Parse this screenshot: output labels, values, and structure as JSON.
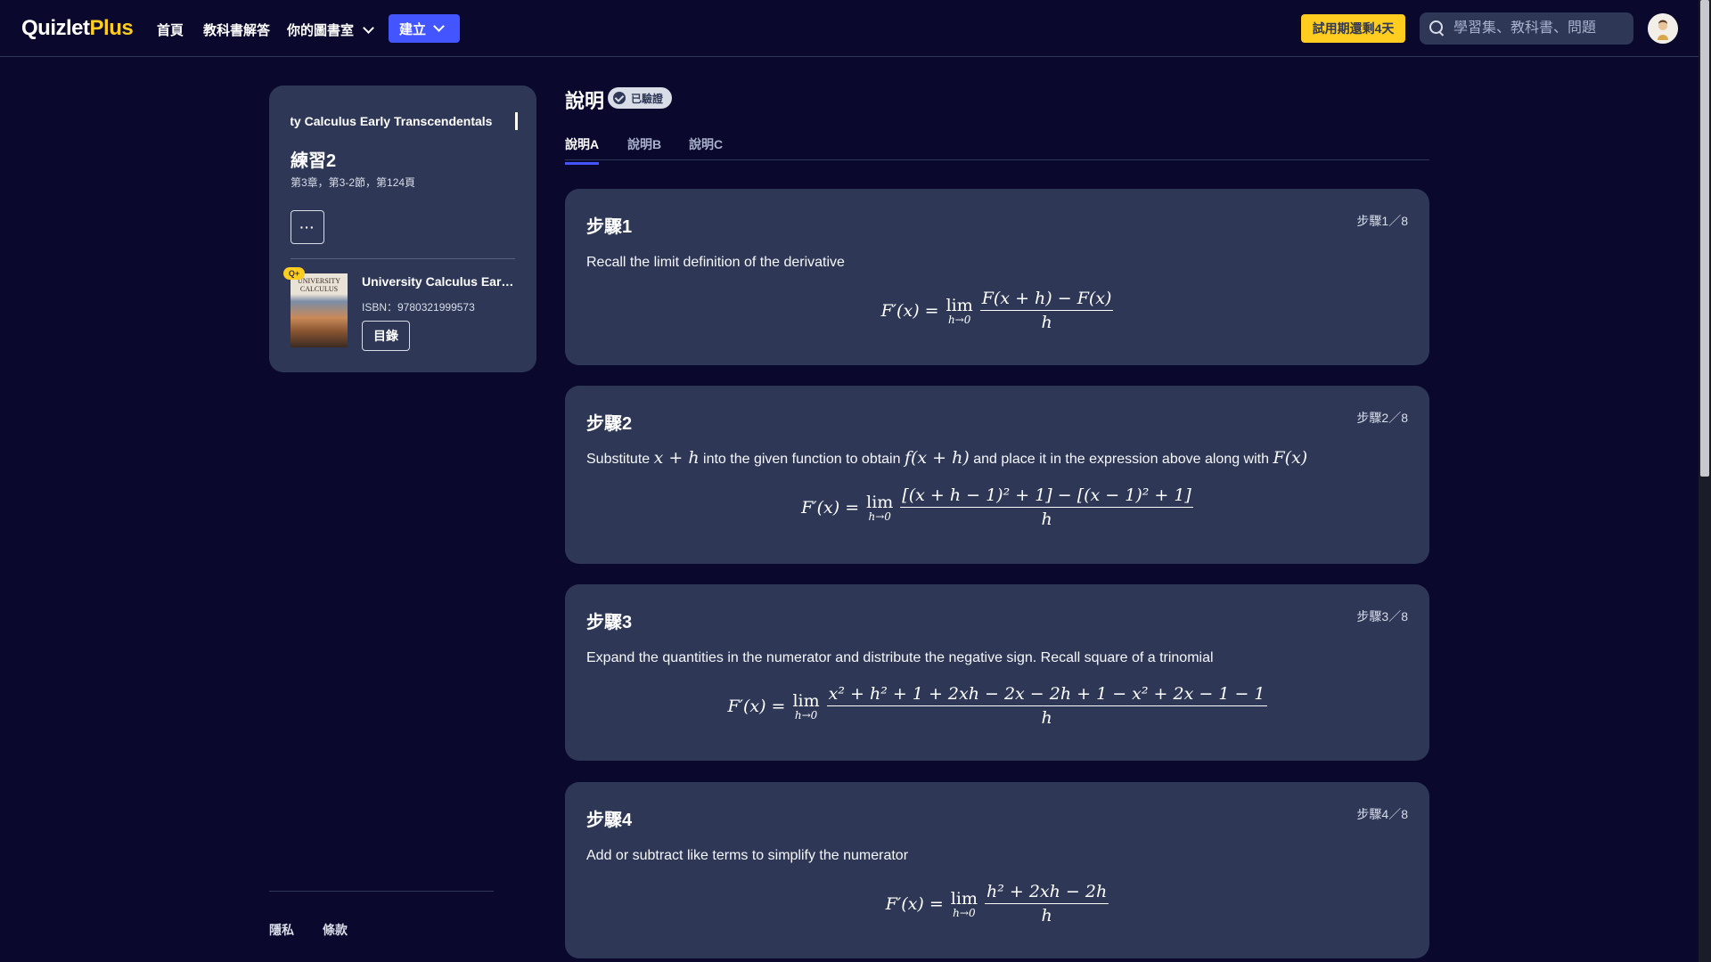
{
  "nav": {
    "logo_main": "Quizlet",
    "logo_plus": "Plus",
    "home": "首頁",
    "solutions": "教科書解答",
    "library": "你的圖書室",
    "create": "建立",
    "trial": "試用期還剩4天",
    "search_placeholder": "學習集、教科書、問題"
  },
  "sidebar": {
    "marquee": "University Calculus Early Transcendentals",
    "exercise_title": "練習2",
    "exercise_sub": "第3章，第3-2節，第124頁",
    "more": "···",
    "qbadge": "Q+",
    "book": {
      "cover_text": "UNIVERSITY CALCULUS",
      "title": "University Calculus Early Transcendentals",
      "isbn": "ISBN：9780321999573",
      "toc": "目錄"
    }
  },
  "footer": {
    "privacy": "隱私",
    "terms": "條款"
  },
  "main": {
    "title": "說明",
    "verified": "已驗證",
    "tabs": [
      "說明A",
      "說明B",
      "說明C"
    ],
    "steps": [
      {
        "title": "步驟1",
        "count": "步驟1／8",
        "text": "Recall the limit definition of the derivative",
        "lhs": "F′(x) =",
        "num": "F(x + h) − F(x)",
        "den": "h"
      },
      {
        "title": "步驟2",
        "count": "步驟2／8",
        "text_1": "Substitute",
        "math_1": "x + h",
        "text_2": "into the given function to obtain",
        "math_2": "f(x + h)",
        "text_3": "and place it in the expression above along with",
        "math_3": "F(x)",
        "lhs": "F′(x) =",
        "num": "[(x + h − 1)² + 1] − [(x − 1)² + 1]",
        "den": "h"
      },
      {
        "title": "步驟3",
        "count": "步驟3／8",
        "text": "Expand the quantities in the numerator and distribute the negative sign. Recall square of a trinomial",
        "lhs": "F′(x) =",
        "num": "x² + h² + 1 + 2xh − 2x − 2h + 1 − x² + 2x − 1 − 1",
        "den": "h"
      },
      {
        "title": "步驟4",
        "count": "步驟4／8",
        "text": "Add or subtract like terms to simplify the numerator",
        "lhs": "F′(x) =",
        "num": "h² + 2xh − 2h",
        "den": "h"
      }
    ],
    "lim_word": "lim",
    "lim_sub": "h→0"
  }
}
